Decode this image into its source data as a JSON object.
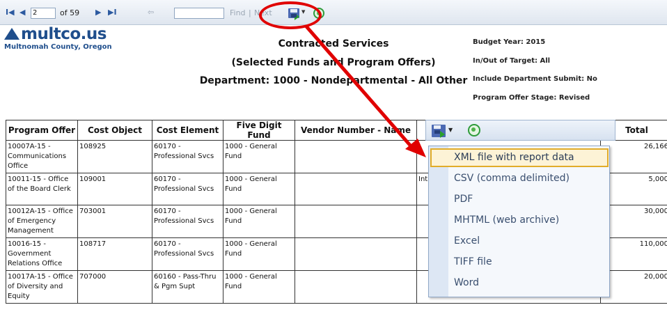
{
  "toolbar": {
    "first_icon": "first-page-icon",
    "prev_icon": "previous-page-icon",
    "page_number": "2",
    "page_of": "of 59",
    "next_icon": "next-page-icon",
    "last_icon": "last-page-icon",
    "back_icon": "back-icon",
    "find_label": "Find",
    "separator": "|",
    "next_label": "Next",
    "export_icon": "export-save-icon",
    "refresh_icon": "refresh-icon"
  },
  "logo": {
    "name": "multco.us",
    "subtitle": "Multnomah County, Oregon"
  },
  "report": {
    "title": "Contracted Services",
    "subtitle": "(Selected Funds and Program Offers)",
    "department": "Department:  1000 - Nondepartmental - All Other",
    "meta": [
      "Budget Year: 2015",
      "In/Out of Target: All",
      "Include Department Submit: No",
      "Program Offer Stage: Revised"
    ]
  },
  "table": {
    "headers": [
      "Program Offer",
      "Cost Object",
      "Cost Element",
      "Five Digit Fund",
      "Vendor Number - Name",
      "",
      "Total"
    ],
    "rows": [
      [
        "10007A-15 - Communications Office",
        "108925",
        "60170 - Professional Svcs",
        "1000 - General Fund",
        "",
        "",
        "26,166"
      ],
      [
        "10011-15 - Office of the Board Clerk",
        "109001",
        "60170 - Professional Svcs",
        "1000 - General Fund",
        "",
        "Int",
        "5,000"
      ],
      [
        "10012A-15 - Office of Emergency Management",
        "703001",
        "60170 - Professional Svcs",
        "1000 - General Fund",
        "",
        "",
        "30,000"
      ],
      [
        "10016-15 - Government Relations Office",
        "108717",
        "60170 - Professional Svcs",
        "1000 - General Fund",
        "",
        "",
        "110,000"
      ],
      [
        "10017A-15 - Office of Diversity and Equity",
        "707000",
        "60160 - Pass-Thru & Pgm Supt",
        "1000 - General Fund",
        "",
        "",
        "20,000"
      ]
    ]
  },
  "export_menu": {
    "items": [
      "XML file with report data",
      "CSV (comma delimited)",
      "PDF",
      "MHTML (web archive)",
      "Excel",
      "TIFF file",
      "Word"
    ],
    "highlighted_index": 0
  },
  "colors": {
    "annotation": "#e00000",
    "logo": "#1f4e8c",
    "highlight_border": "#e1ac29"
  }
}
